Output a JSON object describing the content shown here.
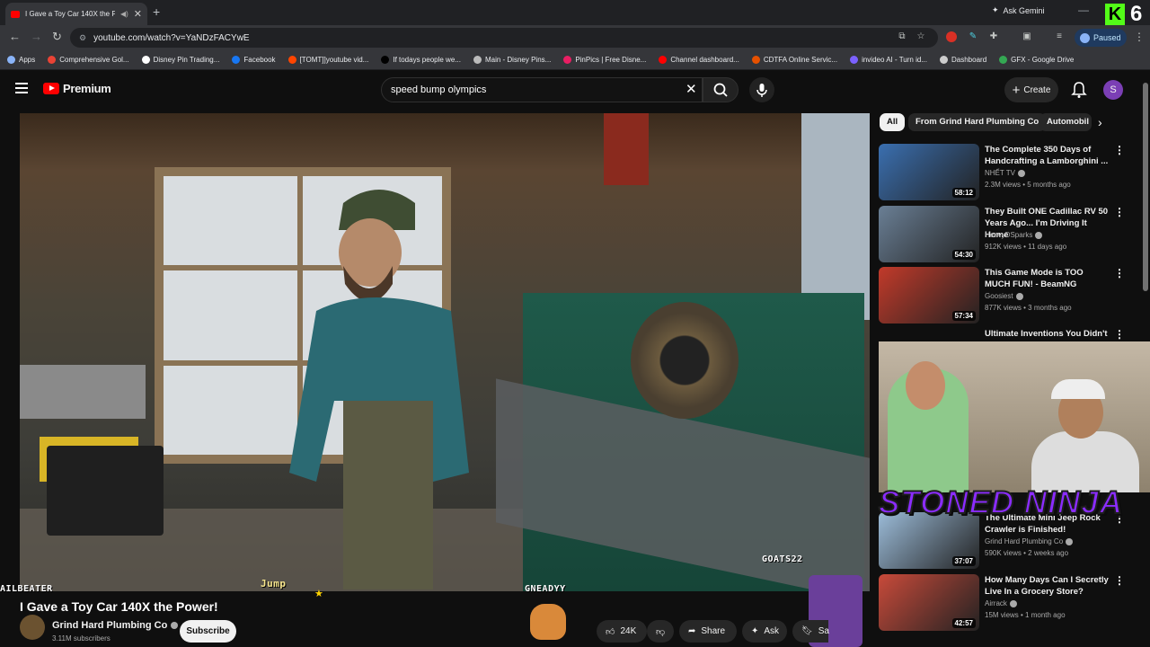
{
  "browser": {
    "tab_title": "I Gave a Toy Car 140X the P",
    "ask_gemini": "Ask Gemini",
    "url": "youtube.com/watch?v=YaNDzFACYwE",
    "profile_status": "Paused",
    "badge_number": "6",
    "bookmarks": [
      {
        "label": "Apps",
        "color": "#8ab4f8"
      },
      {
        "label": "Comprehensive Gol...",
        "color": "#ea4335"
      },
      {
        "label": "Disney Pin Trading...",
        "color": "#ffffff"
      },
      {
        "label": "Facebook",
        "color": "#1877f2"
      },
      {
        "label": "[TOMT]]youtube vid...",
        "color": "#ff4500"
      },
      {
        "label": "If todays people we...",
        "color": "#000000"
      },
      {
        "label": "Main - Disney Pins...",
        "color": "#bbbbbb"
      },
      {
        "label": "PinPics | Free Disne...",
        "color": "#e91e63"
      },
      {
        "label": "Channel dashboard...",
        "color": "#ff0000"
      },
      {
        "label": "CDTFA Online Servic...",
        "color": "#e65100"
      },
      {
        "label": "invideo AI - Turn id...",
        "color": "#7b61ff"
      },
      {
        "label": "Dashboard",
        "color": "#cccccc"
      },
      {
        "label": "GFX - Google Drive",
        "color": "#34a853"
      }
    ]
  },
  "youtube": {
    "logo_text": "Premium",
    "search_query": "speed bump olympics",
    "create_label": "Create",
    "avatar_letter": "S"
  },
  "video": {
    "title": "I Gave a Toy Car 140X the Power!",
    "channel": "Grind Hard Plumbing Co",
    "subscribers": "3.11M subscribers",
    "subscribe_label": "Subscribe",
    "likes": "24K",
    "share_label": "Share",
    "ask_label": "Ask",
    "save_label": "Sa",
    "overlay_left": "AILBEATER",
    "overlay_mid": "GNEADYY",
    "overlay_right": "GOATS22",
    "overlay_jump": "Jump",
    "stream_banner": "STONED NINJA"
  },
  "chips": [
    "All",
    "From Grind Hard Plumbing Co",
    "Automobil"
  ],
  "recommendations": [
    {
      "title": "The Complete 350 Days of Handcrafting a Lamborghini ...",
      "channel": "NHẾT TV",
      "meta": "2.3M views • 5 months ago",
      "duration": "58:12",
      "thumb": "#3a6fb0"
    },
    {
      "title": "They Built ONE Cadillac RV 50 Years Ago... I'm Driving It Home",
      "channel": "HeavyDSparks",
      "meta": "912K views • 11 days ago",
      "duration": "54:30",
      "thumb": "#6a7f95"
    },
    {
      "title": "This Game Mode is TOO MUCH FUN! - BeamNG",
      "channel": "Goosiest",
      "meta": "877K views • 3 months ago",
      "duration": "57:34",
      "thumb": "#c23a2a"
    },
    {
      "title": "Ultimate Inventions You Didn't",
      "channel": "",
      "meta": "",
      "duration": "",
      "thumb": "#777777"
    },
    {
      "title": "The Ultimate Mini Jeep Rock Crawler is Finished!",
      "channel": "Grind Hard Plumbing Co",
      "meta": "590K views • 2 weeks ago",
      "duration": "37:07",
      "thumb": "#9bbbd8"
    },
    {
      "title": "How Many Days Can I Secretly Live In a Grocery Store?",
      "channel": "Airrack",
      "meta": "15M views • 1 month ago",
      "duration": "42:57",
      "thumb": "#c84a3a"
    }
  ]
}
